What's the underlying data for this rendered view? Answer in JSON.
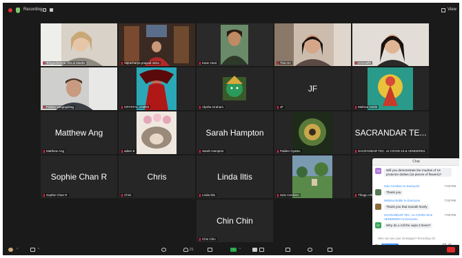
{
  "topbar": {
    "recording_label": "Recording...",
    "view_label": "View"
  },
  "tiles": [
    {
      "name": "Tenguchenma Alila & Masks",
      "display": "",
      "active": true
    },
    {
      "name": "Vajracharya prajwal ratna",
      "display": ""
    },
    {
      "name": "Kaon Hunt",
      "display": ""
    },
    {
      "name": "Tina Ho",
      "display": ""
    },
    {
      "name": "cococaffe",
      "display": ""
    },
    {
      "name": "Palden sangngidrag",
      "display": ""
    },
    {
      "name": "CRYSTAL JAMES",
      "display": ""
    },
    {
      "name": "Alysha Graham",
      "display": ""
    },
    {
      "name": "JF",
      "display": "JF"
    },
    {
      "name": "Melissa Noble",
      "display": ""
    },
    {
      "name": "Matthew Ang",
      "display": "Matthew Ang"
    },
    {
      "name": "adam B",
      "display": ""
    },
    {
      "name": "Sarah Hampton",
      "display": "Sarah Hampton"
    },
    {
      "name": "Palden Gyatso",
      "display": ""
    },
    {
      "name": "SACRANDAR TEC. vs COVID-19 & VENDERES",
      "display": "SACRANDAR TE..."
    },
    {
      "name": "Sophie Chan R",
      "display": "Sophie Chan R"
    },
    {
      "name": "Chris",
      "display": "Chris"
    },
    {
      "name": "Linda Iltis",
      "display": "Linda Iltis"
    },
    {
      "name": "Sulo Cerdeiro",
      "display": ""
    },
    {
      "name": "Thiago Alba",
      "display": ""
    },
    {
      "name": "Chin Chin",
      "display": "Chin Chin"
    }
  ],
  "chat": {
    "title": "Chat",
    "messages": [
      {
        "avatar": "TH",
        "avatar_color": "#b07ad9",
        "text": "Will you demonstrate the mudras of 16 protector deities (16 pieces of flowers)?"
      },
      {
        "sender": "Sulo Cerdeiro to Everyone",
        "time": "7:03 PM",
        "avatar_color": "#557a55",
        "text": "Thank you"
      },
      {
        "sender": "Melissa Noble to Everyone",
        "time": "7:03 PM",
        "avatar_color": "#8a6a3a",
        "text": "Thank you that sounds lovely"
      },
      {
        "sender": "SACRANDAR TEC. vs COVID-19 & VENDERES to Everyone",
        "time": "7:03 PM",
        "avatar": "ST",
        "avatar_color": "#3aa65a",
        "text": "Why do u roll the vajra 3 times?"
      }
    ],
    "notice": "Who can see your messages? Recording On",
    "to_label": "To:",
    "to_value": "Everyone",
    "input_placeholder": "Type message here..."
  },
  "toolbar": {
    "participants_count": "21"
  },
  "colors": {
    "background": "#1a1a1a",
    "tile": "#262626",
    "active_speaker": "#7ec86c",
    "accent": "#2d8cff",
    "leave": "#e02828"
  }
}
